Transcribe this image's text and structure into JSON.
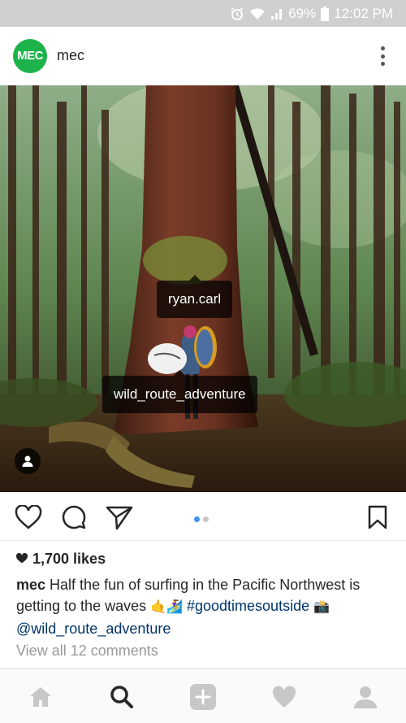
{
  "status_bar": {
    "battery": "69%",
    "time": "12:02 PM",
    "icons": [
      "alarm-icon",
      "wifi-icon",
      "signal-icon",
      "battery-icon"
    ]
  },
  "post": {
    "avatar_text": "MEC",
    "username": "mec",
    "tags": [
      "ryan.carl",
      "wild_route_adventure"
    ],
    "likes": "1,700 likes",
    "caption_user": "mec",
    "caption_text": "Half the fun of surfing in the Pacific Northwest is getting to the waves",
    "caption_emojis": "🤙🏄‍♀️",
    "hashtag": "#goodtimesoutside",
    "mention": "@wild_route_adventure",
    "view_comments": "View all 12 comments",
    "carousel_index": 1,
    "carousel_count": 2
  },
  "colors": {
    "brand": "#1db34a",
    "link": "#003569",
    "active_dot": "#3897f0",
    "inactive_dot": "#c7c7c7"
  },
  "nav": [
    "home-icon",
    "search-icon",
    "add-icon",
    "activity-icon",
    "profile-icon"
  ]
}
